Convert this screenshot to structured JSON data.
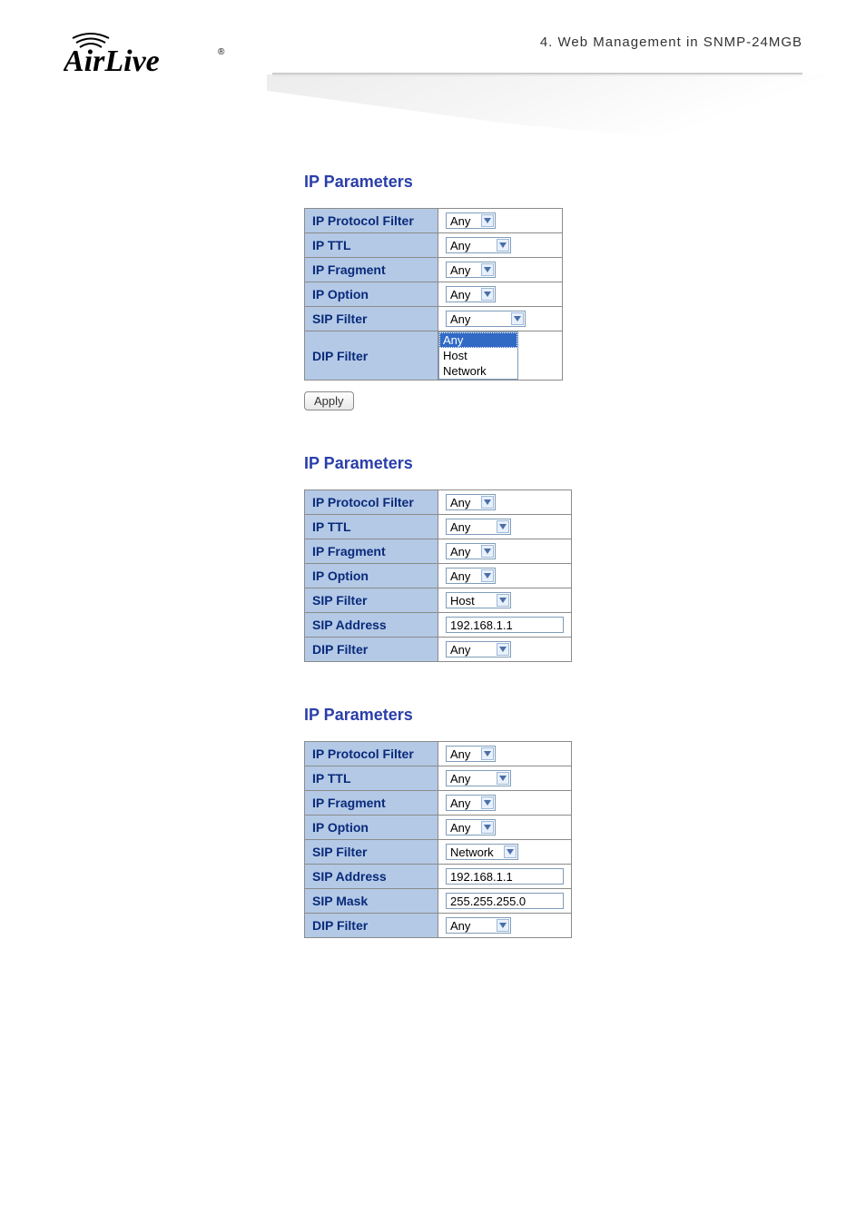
{
  "header": {
    "chapter": "4.  Web Management in SNMP-24MGB",
    "logo_text": "AirLive"
  },
  "sections": [
    {
      "title": "IP Parameters",
      "rows": [
        {
          "label": "IP Protocol Filter",
          "type": "select",
          "value": "Any",
          "width": "sel-55"
        },
        {
          "label": "IP TTL",
          "type": "select",
          "value": "Any",
          "width": "sel-72"
        },
        {
          "label": "IP Fragment",
          "type": "select",
          "value": "Any",
          "width": "sel-55"
        },
        {
          "label": "IP Option",
          "type": "select",
          "value": "Any",
          "width": "sel-55"
        },
        {
          "label": "SIP Filter",
          "type": "select",
          "value": "Any",
          "width": "sel-86"
        },
        {
          "label": "DIP Filter",
          "type": "dropdown-open",
          "selected": "Any",
          "options": [
            "Any",
            "Host",
            "Network"
          ]
        }
      ],
      "apply_label": "Apply"
    },
    {
      "title": "IP Parameters",
      "rows": [
        {
          "label": "IP Protocol Filter",
          "type": "select",
          "value": "Any",
          "width": "sel-55"
        },
        {
          "label": "IP TTL",
          "type": "select",
          "value": "Any",
          "width": "sel-72"
        },
        {
          "label": "IP Fragment",
          "type": "select",
          "value": "Any",
          "width": "sel-55"
        },
        {
          "label": "IP Option",
          "type": "select",
          "value": "Any",
          "width": "sel-55"
        },
        {
          "label": "SIP Filter",
          "type": "select",
          "value": "Host",
          "width": "sel-72"
        },
        {
          "label": "SIP Address",
          "type": "text",
          "value": "192.168.1.1"
        },
        {
          "label": "DIP Filter",
          "type": "select",
          "value": "Any",
          "width": "sel-72"
        }
      ]
    },
    {
      "title": "IP Parameters",
      "rows": [
        {
          "label": "IP Protocol Filter",
          "type": "select",
          "value": "Any",
          "width": "sel-55"
        },
        {
          "label": "IP TTL",
          "type": "select",
          "value": "Any",
          "width": "sel-72"
        },
        {
          "label": "IP Fragment",
          "type": "select",
          "value": "Any",
          "width": "sel-55"
        },
        {
          "label": "IP Option",
          "type": "select",
          "value": "Any",
          "width": "sel-55"
        },
        {
          "label": "SIP Filter",
          "type": "select",
          "value": "Network",
          "width": "sel-80"
        },
        {
          "label": "SIP Address",
          "type": "text",
          "value": "192.168.1.1"
        },
        {
          "label": "SIP Mask",
          "type": "text",
          "value": "255.255.255.0"
        },
        {
          "label": "DIP Filter",
          "type": "select",
          "value": "Any",
          "width": "sel-72"
        }
      ]
    }
  ]
}
